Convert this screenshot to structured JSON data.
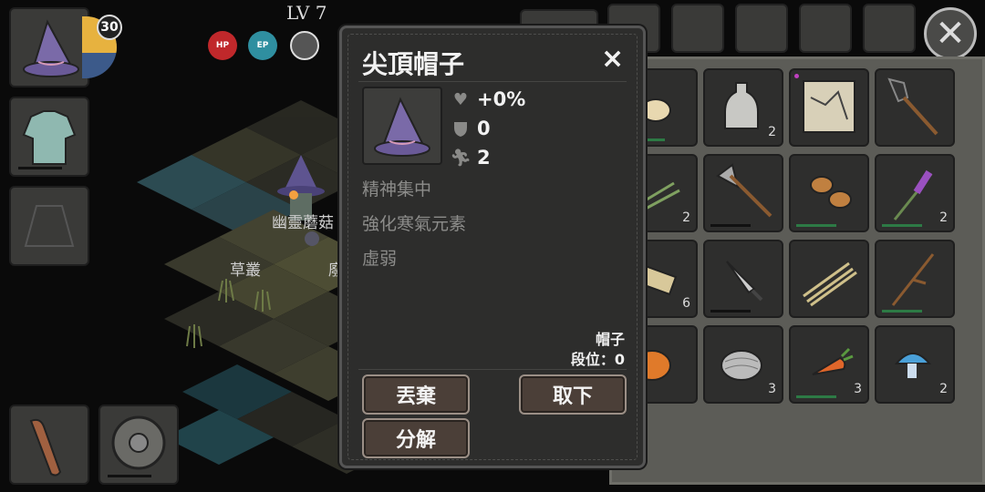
{
  "hud": {
    "level": "LV 7",
    "level_badge": "30",
    "hp_label": "HP",
    "ep_label": "EP"
  },
  "world": {
    "labels": [
      "幽靈蘑菇",
      "草叢",
      "廢"
    ]
  },
  "popup": {
    "title": "尖頂帽子",
    "close": "×",
    "stats": [
      {
        "icon": "heart-icon",
        "value": "+0%"
      },
      {
        "icon": "shield-icon",
        "value": "0"
      },
      {
        "icon": "runner-icon",
        "value": "2"
      }
    ],
    "effects": [
      "精神集中",
      "強化寒氣元素",
      "虛弱"
    ],
    "category": "帽子",
    "tier": "段位：0",
    "buttons": {
      "discard": "丟棄",
      "unequip": "取下",
      "decompose": "分解"
    }
  },
  "inventory": {
    "slots": [
      {
        "item": "pumpkin-icon",
        "count": ""
      },
      {
        "item": "bottle-icon",
        "count": "2"
      },
      {
        "item": "map-icon",
        "count": ""
      },
      {
        "item": "shovel-icon",
        "count": ""
      },
      {
        "item": "grass-bundle-icon",
        "count": "2"
      },
      {
        "item": "pickaxe-icon",
        "count": ""
      },
      {
        "item": "potato-icon",
        "count": ""
      },
      {
        "item": "lavender-icon",
        "count": "2"
      },
      {
        "item": "log-bundle-icon",
        "count": "6"
      },
      {
        "item": "knife-icon",
        "count": ""
      },
      {
        "item": "hay-bundle-icon",
        "count": ""
      },
      {
        "item": "branch-icon",
        "count": ""
      },
      {
        "item": "orange-blob-icon",
        "count": ""
      },
      {
        "item": "yarn-ball-icon",
        "count": "3"
      },
      {
        "item": "carrot-icon",
        "count": "3"
      },
      {
        "item": "blue-mushroom-icon",
        "count": "2"
      }
    ]
  },
  "colors": {
    "hp": "#c0282b",
    "ep": "#2f8fa0",
    "hat_purple": "#7a6aa8",
    "button_fill": "#4b3f38",
    "durability_bar": "#2d7a45"
  }
}
